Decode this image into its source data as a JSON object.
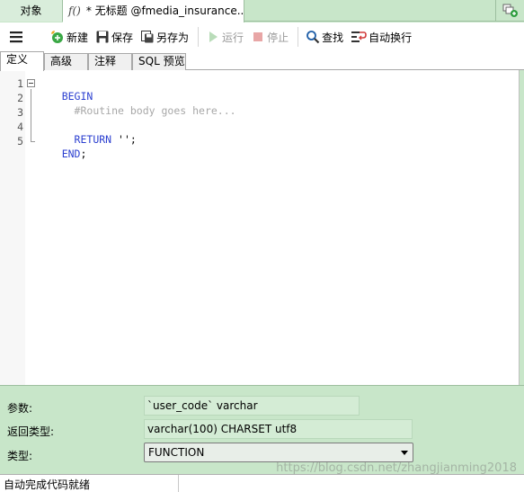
{
  "tabs": {
    "objects_label": "对象",
    "active_prefix": "f()",
    "active_title": "* 无标题 @fmedia_insurance..."
  },
  "toolbar": {
    "menu_icon": "hamburger-icon",
    "new_label": "新建",
    "save_label": "保存",
    "save_as_label": "另存为",
    "run_label": "运行",
    "stop_label": "停止",
    "find_label": "查找",
    "wrap_label": "自动换行"
  },
  "subtabs": [
    "定义",
    "高级",
    "注释",
    "SQL 预览"
  ],
  "editor": {
    "line_numbers": [
      "1",
      "2",
      "3",
      "4",
      "5"
    ],
    "lines": [
      {
        "parts": [
          {
            "t": "BEGIN",
            "c": "kw"
          }
        ]
      },
      {
        "parts": [
          {
            "t": "  #Routine body goes here...",
            "c": "cm"
          }
        ]
      },
      {
        "parts": []
      },
      {
        "parts": [
          {
            "t": "  RETURN ",
            "c": "kw"
          },
          {
            "t": "'';",
            "c": "plain"
          }
        ]
      },
      {
        "parts": [
          {
            "t": "END",
            "c": "kw"
          },
          {
            "t": ";",
            "c": "plain"
          }
        ]
      }
    ]
  },
  "properties": {
    "params_label": "参数:",
    "params_value": "`user_code` varchar",
    "return_label": "返回类型:",
    "return_value": "varchar(100) CHARSET utf8",
    "type_label": "类型:",
    "type_value": "FUNCTION"
  },
  "status": {
    "text": "自动完成代码就绪"
  },
  "watermark": "https://blog.csdn.net/zhangjianming2018",
  "colors": {
    "panel_green": "#c8e6c9",
    "keyword_blue": "#2b3fd0",
    "comment_gray": "#a8a8a8"
  }
}
